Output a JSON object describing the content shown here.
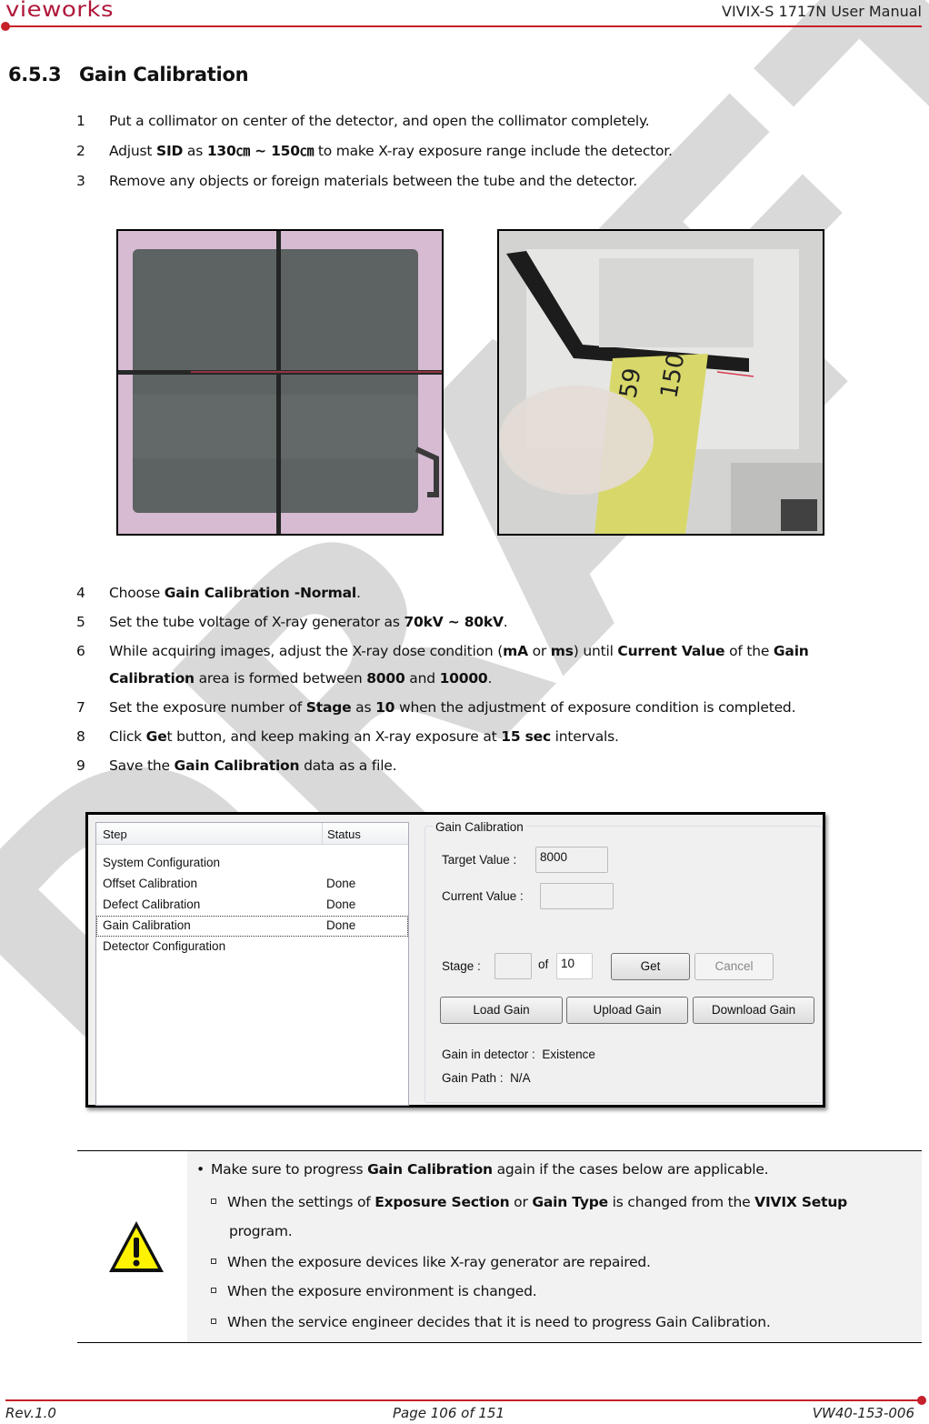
{
  "header": {
    "brand": "vieworks",
    "doc_title": "VIVIX-S 1717N User Manual",
    "accent_color": "#c6202a"
  },
  "watermark": "DRAFT",
  "section": {
    "number": "6.5.3",
    "title": "Gain Calibration"
  },
  "steps_a": [
    {
      "n": "1",
      "text": "Put a collimator on center of the detector, and open the collimator completely."
    },
    {
      "n": "2",
      "pre": "Adjust ",
      "b1": "SID",
      "mid": " as ",
      "b2": "130㎝ ~ 150㎝",
      "post": " to make X-ray exposure range include the detector."
    },
    {
      "n": "3",
      "text": "Remove any objects or foreign materials between the tube and the detector."
    }
  ],
  "photos": [
    {
      "name": "detector-with-crosshair-photo",
      "alt": "Detector panel under collimator crosshair"
    },
    {
      "name": "tape-measure-sid-photo",
      "alt": "Measuring SID with tape measure at 150"
    }
  ],
  "steps_b": {
    "s4": {
      "n": "4",
      "pre": "Choose ",
      "b1": "Gain Calibration -Normal",
      "post": "."
    },
    "s5": {
      "n": "5",
      "pre": "Set the tube voltage of X-ray generator as ",
      "b1": "70kV ~ 80kV",
      "post": "."
    },
    "s6": {
      "n": "6",
      "pre": "While acquiring images, adjust the X-ray dose condition (",
      "b1": "mA",
      "mid1": " or ",
      "b2": "ms",
      "mid2": ") until ",
      "b3": "Current Value",
      "mid3": " of the ",
      "b4": "Gain",
      "cont_b": "Calibration",
      "cont_mid": " area is formed between ",
      "cont_b2": "8000",
      "cont_mid2": " and ",
      "cont_b3": "10000",
      "cont_post": "."
    },
    "s7": {
      "n": "7",
      "pre": "Set the exposure number of ",
      "b1": "Stage",
      "mid": " as ",
      "b2": "10",
      "post": " when the adjustment of exposure condition is completed."
    },
    "s8": {
      "n": "8",
      "pre": "Click ",
      "b1": "Ge",
      "post": "t button, and keep making an X-ray exposure at ",
      "b2": "15 sec",
      "post2": " intervals."
    },
    "s9": {
      "n": "9",
      "pre": "Save the ",
      "b1": "Gain Calibration",
      "post": " data as a file."
    }
  },
  "software": {
    "step_list": {
      "col_step": "Step",
      "col_status": "Status",
      "rows": [
        {
          "step": "System Configuration",
          "status": ""
        },
        {
          "step": "Offset Calibration",
          "status": "Done"
        },
        {
          "step": "Defect Calibration",
          "status": "Done"
        },
        {
          "step": "Gain Calibration",
          "status": "Done"
        },
        {
          "step": "Detector Configuration",
          "status": ""
        }
      ]
    },
    "gain_group": {
      "title": "Gain Calibration",
      "target_label": "Target Value :",
      "target_value": "8000",
      "current_label": "Current Value :",
      "current_value": "",
      "stage_label": "Stage :",
      "stage_value": "",
      "of_label": "of",
      "stage_total": "10",
      "get_button": "Get",
      "cancel_button": "Cancel",
      "load_button": "Load Gain",
      "upload_button": "Upload Gain",
      "download_button": "Download Gain",
      "gain_in_detector_label": "Gain in detector :",
      "gain_in_detector_value": "Existence",
      "gain_path_label": "Gain Path :",
      "gain_path_value": "N/A"
    }
  },
  "caution": {
    "intro_pre": "Make sure to progress ",
    "intro_b": "Gain Calibration",
    "intro_post": " again if the cases below are applicable.",
    "case1_pre": "When the settings of ",
    "case1_b1": "Exposure Section",
    "case1_mid": " or ",
    "case1_b2": "Gain Type",
    "case1_mid2": " is changed from the ",
    "case1_b3": "VIVIX Setup",
    "case1_cont": "program.",
    "case2": "When the exposure devices like X-ray generator are repaired.",
    "case3": "When the exposure environment is changed.",
    "case4": "When the service engineer decides that it is need to progress Gain Calibration."
  },
  "footer": {
    "rev": "Rev.1.0",
    "page": "Page 106 of 151",
    "doc_no": "VW40-153-006"
  }
}
